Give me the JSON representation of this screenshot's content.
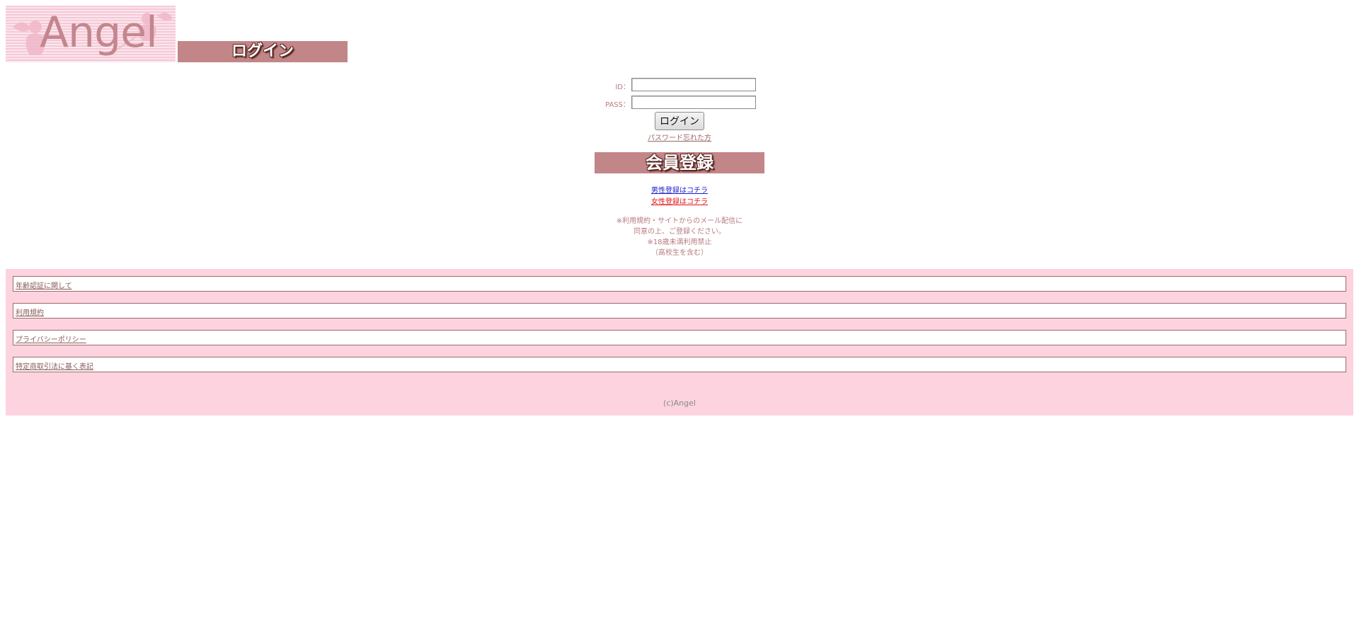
{
  "header": {
    "logo_text": "Angel",
    "login_title": "ログイン"
  },
  "form": {
    "id_label": "ID：",
    "pass_label": "PASS：",
    "id_value": "",
    "pass_value": "",
    "login_button": "ログイン",
    "forgot_link": "パスワード忘れた方"
  },
  "register": {
    "title": "会員登録",
    "male_link": "男性登録はコチラ",
    "female_link": "女性登録はコチラ",
    "note_line1": "※利用規約・サイトからのメール配信に",
    "note_line2": "同意の上、ご登録ください。",
    "note_line3": "※18歳未満利用禁止",
    "note_line4": "（高校生を含む）"
  },
  "footer": {
    "items": [
      {
        "label": "年齢認証に関して"
      },
      {
        "label": "利用規約"
      },
      {
        "label": "プライバシーポリシー"
      },
      {
        "label": "特定商取引法に基く表記"
      }
    ],
    "copyright": "(c)Angel"
  },
  "colors": {
    "title_bar": "#c38688",
    "footer_bg": "#fdd3e0",
    "label_text": "#b9797f",
    "male_link": "#1a1acc",
    "female_link": "#e01212"
  }
}
